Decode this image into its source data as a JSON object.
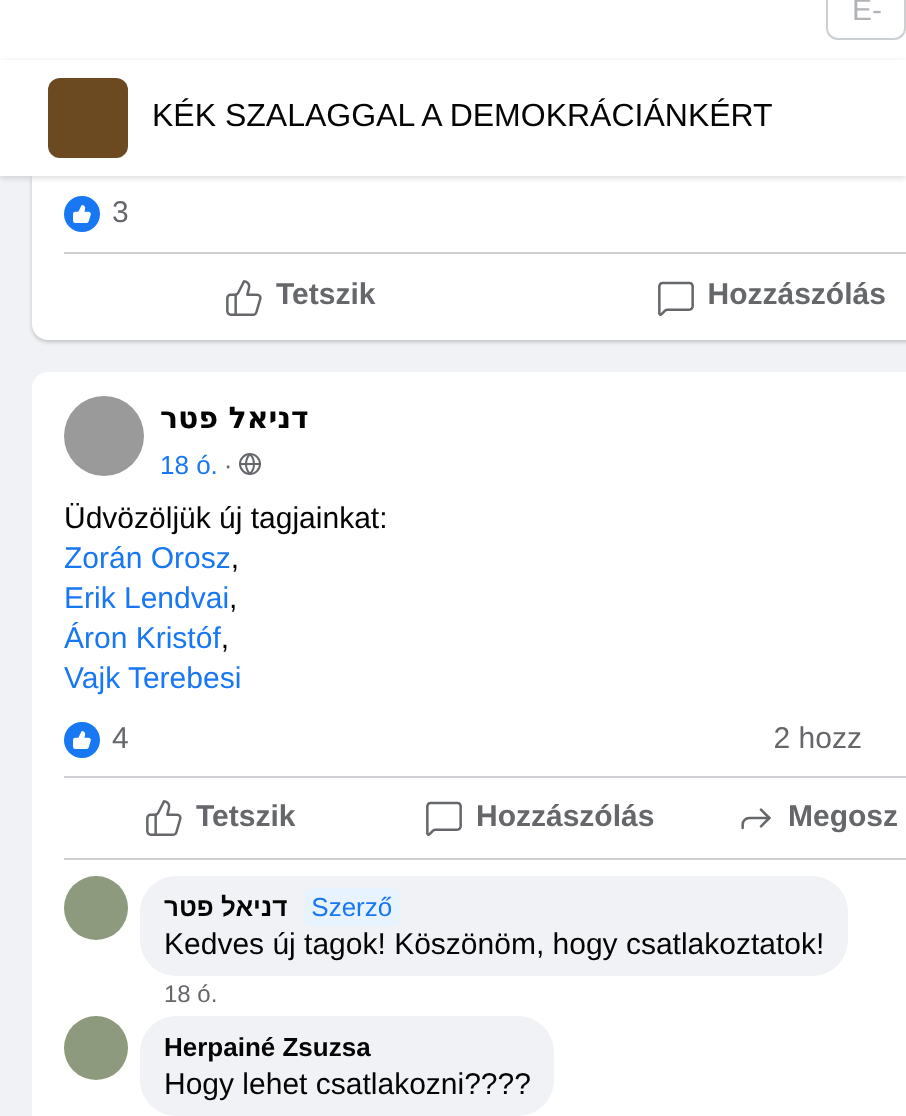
{
  "top_bar": {
    "field_placeholder": "E-"
  },
  "group_header": {
    "title": "KÉK SZALAGGAL A DEMOKRÁCIÁNKÉRT"
  },
  "previous_post": {
    "like_count": "3",
    "actions": [
      "Tetszik",
      "Hozzászólás"
    ]
  },
  "post": {
    "author": "דניאל פטר",
    "time": "18 ó.",
    "separator": "·",
    "intro": "Üdvözöljük új tagjainkat:",
    "mentions": [
      {
        "name": "Zorán Orosz",
        "suffix": ","
      },
      {
        "name": "Erik Lendvai",
        "suffix": ","
      },
      {
        "name": "Áron Kristóf",
        "suffix": ","
      },
      {
        "name": "Vajk Terebesi"
      }
    ],
    "like_count": "4",
    "comment_count": "2 hozz",
    "actions": [
      {
        "kind": "like",
        "label": "Tetszik"
      },
      {
        "kind": "comment",
        "label": "Hozzászólás"
      },
      {
        "kind": "share",
        "label": "Megosz"
      }
    ]
  },
  "comments": [
    {
      "author": "דניאל פטר",
      "badge": "Szerző",
      "text": "Kedves új tagok! Köszönöm, hogy csatlakoztatok!",
      "time": "18 ó."
    },
    {
      "author": "Herpainé Zsuzsa",
      "text": "Hogy lehet csatlakozni????"
    }
  ]
}
